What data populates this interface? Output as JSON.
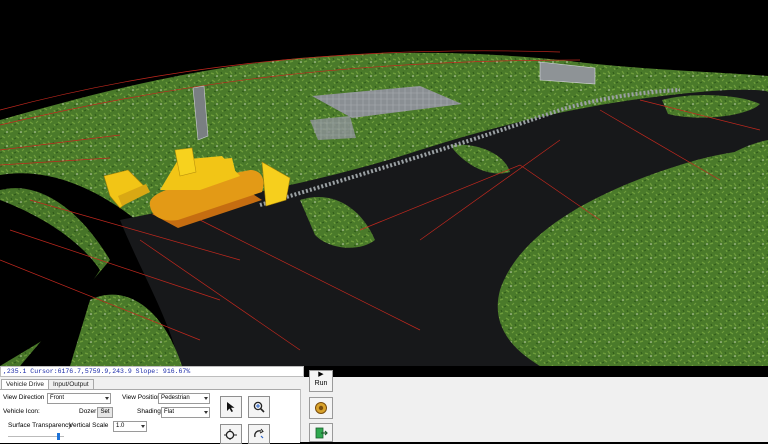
{
  "status_bar": {
    "text": ",235.1  Cursor:6176.7,5759.9,243.9 Slope: 916.67%"
  },
  "tabs": [
    {
      "label": "Vehicle Drive",
      "active": true
    },
    {
      "label": "Input/Output",
      "active": false
    }
  ],
  "controls": {
    "view_direction": {
      "label": "View Direction",
      "value": "Front"
    },
    "view_position": {
      "label": "View Position",
      "value": "Pedestrian"
    },
    "vehicle_icon": {
      "label": "Vehicle Icon:",
      "name": "Dozer",
      "set_label": "Set"
    },
    "shading": {
      "label": "Shading",
      "value": "Flat"
    },
    "surface_transparency": {
      "label": "Surface Transparency",
      "level_percent": 90
    },
    "vertical_scale": {
      "label": "Vertical Scale",
      "value": "1.0"
    }
  },
  "toolbar": {
    "run_label": "Run",
    "icons": [
      "pointer-arrow-icon",
      "zoom-icon",
      "pan-zoom-icon",
      "rotate-icon",
      "settings-icon",
      "exit-icon"
    ]
  },
  "colors": {
    "background": "#000000",
    "terrain_grass": "#4f7d2c",
    "road_dark": "#17181a",
    "dozer_yellow": "#f2c516",
    "contour_red": "#c0281e",
    "status_text": "#1a2aa8",
    "panel_bg": "#f0f0f0"
  }
}
